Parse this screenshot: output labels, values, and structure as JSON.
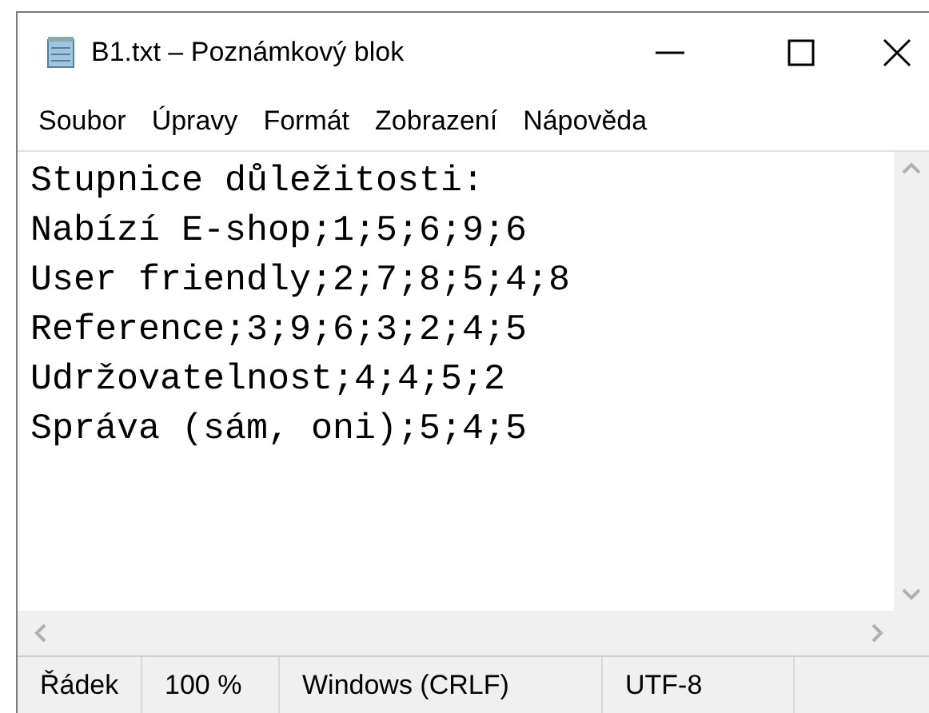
{
  "window": {
    "title": "B1.txt – Poznámkový blok"
  },
  "menu": [
    "Soubor",
    "Úpravy",
    "Formát",
    "Zobrazení",
    "Nápověda"
  ],
  "document": {
    "lines": [
      "Stupnice důležitosti:",
      "Nabízí E-shop;1;5;6;9;6",
      "User friendly;2;7;8;5;4;8",
      "Reference;3;9;6;3;2;4;5",
      "Udržovatelnost;4;4;5;2",
      "Správa (sám, oni);5;4;5"
    ]
  },
  "status_bar": [
    "Řádek",
    "100 %",
    "Windows (CRLF)",
    "UTF-8"
  ]
}
